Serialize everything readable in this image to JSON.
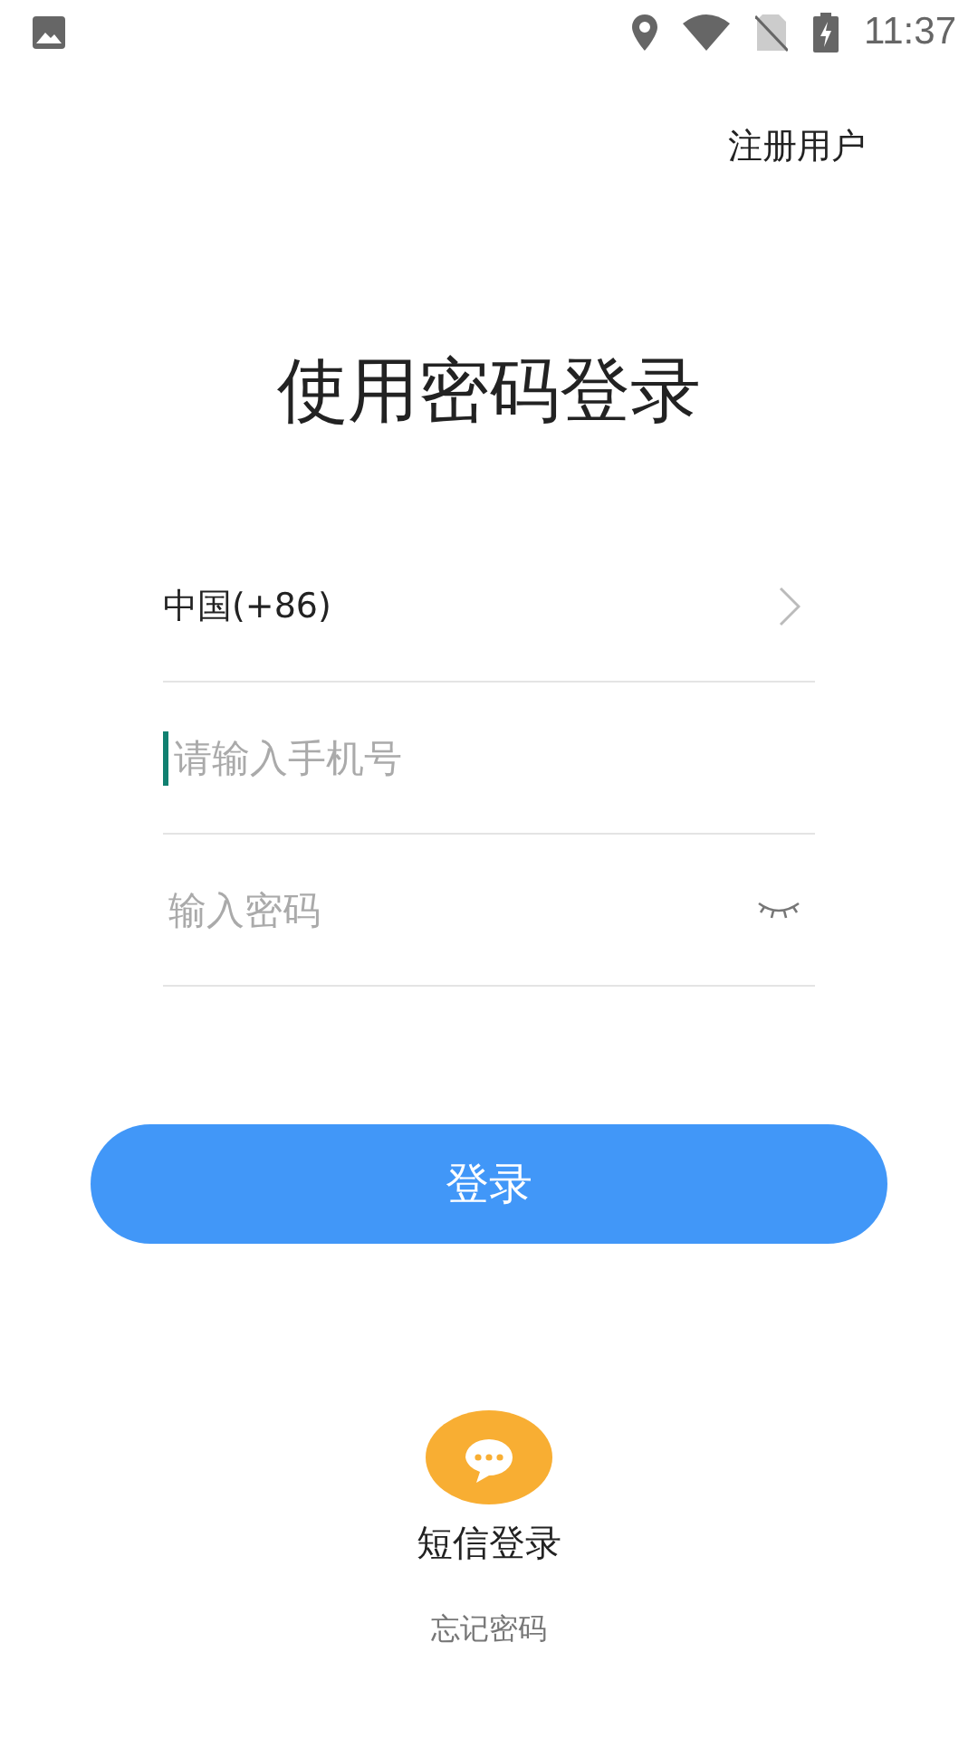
{
  "status_bar": {
    "time": "11:37"
  },
  "top_link": {
    "label": "注册用户"
  },
  "title": "使用密码登录",
  "country": {
    "label": "中国(+86)"
  },
  "phone_field": {
    "placeholder": "请输入手机号",
    "focused": true
  },
  "password_field": {
    "placeholder": "输入密码"
  },
  "login_button": {
    "label": "登录"
  },
  "sms_login": {
    "label": "短信登录"
  },
  "forgot_link": {
    "label": "忘记密码"
  }
}
